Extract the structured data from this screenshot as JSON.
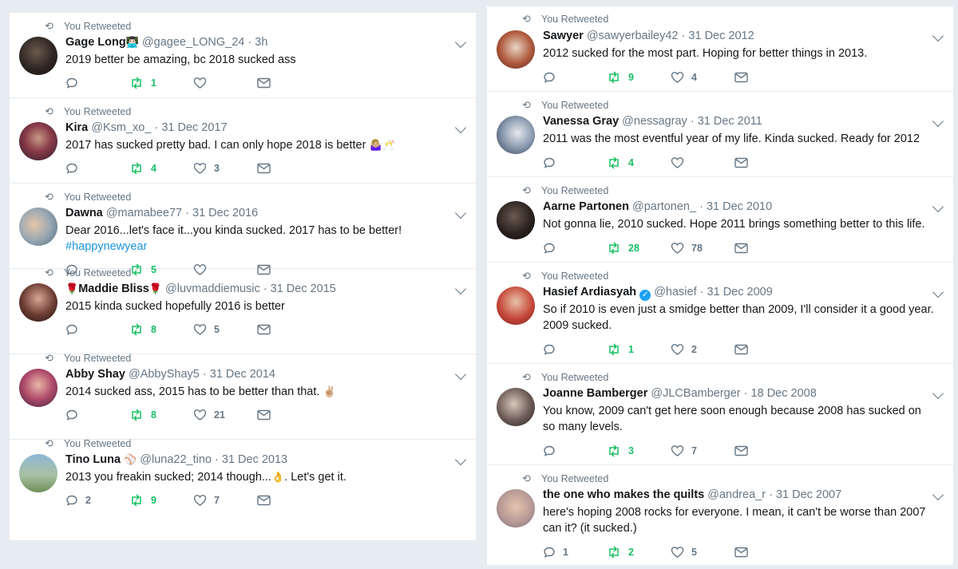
{
  "retweet_label": "You Retweeted",
  "colors": {
    "accent": "#1b95e0",
    "retweet_green": "#17bf63",
    "muted": "#657786",
    "verified": "#1da1f2"
  },
  "left_tweets": [
    {
      "name": "Gage Long",
      "name_suffix": "👨🏻‍💻",
      "handle": "@gagee_LONG_24",
      "date": "3h",
      "text": "2019 better be amazing, bc 2018 sucked ass",
      "replies": "",
      "retweets": "1",
      "likes": ""
    },
    {
      "name": "Kira",
      "handle": "@Ksm_xo_",
      "date": "31 Dec 2017",
      "text": "2017 has sucked pretty bad. I can only hope 2018 is better",
      "text_emoji": "🤷🏼‍♀️🥂",
      "replies": "",
      "retweets": "4",
      "likes": "3"
    },
    {
      "name": "Dawna",
      "handle": "@mamabee77",
      "date": "31 Dec 2016",
      "text": "Dear 2016...let's face it...you kinda sucked. 2017 has to be better!",
      "hashtag": "#happynewyear",
      "replies": "",
      "retweets": "5",
      "likes": ""
    },
    {
      "name_prefix": "🌹",
      "name": "Maddie Bliss",
      "name_suffix": "🌹",
      "handle": "@luvmaddiemusic",
      "date": "31 Dec 2015",
      "text": "2015 kinda sucked hopefully 2016 is better",
      "replies": "",
      "retweets": "8",
      "likes": "5"
    },
    {
      "name": "Abby Shay",
      "handle": "@AbbyShay5",
      "date": "31 Dec 2014",
      "text": "2014 sucked ass, 2015 has to be better than that.",
      "text_emoji": "✌🏼",
      "replies": "",
      "retweets": "8",
      "likes": "21"
    },
    {
      "name": "Tino Luna",
      "name_suffix": "⚾",
      "handle": "@luna22_tino",
      "date": "31 Dec 2013",
      "text": "2013 you freakin sucked; 2014 though...",
      "text_emoji": "👌",
      "text_tail": ". Let's get it.",
      "replies": "2",
      "retweets": "9",
      "likes": "7"
    }
  ],
  "right_tweets": [
    {
      "name": "Sawyer",
      "handle": "@sawyerbailey42",
      "date": "31 Dec 2012",
      "text": "2012 sucked for the most part. Hoping for better things in 2013.",
      "replies": "",
      "retweets": "9",
      "likes": "4"
    },
    {
      "name": "Vanessa Gray",
      "handle": "@nessagray",
      "date": "31 Dec 2011",
      "text": "2011 was the most eventful year of my life. Kinda sucked. Ready for 2012",
      "replies": "",
      "retweets": "4",
      "likes": ""
    },
    {
      "name": "Aarne Partonen",
      "handle": "@partonen_",
      "date": "31 Dec 2010",
      "text": "Not gonna lie, 2010 sucked. Hope 2011 brings something better to this life.",
      "replies": "",
      "retweets": "28",
      "likes": "78"
    },
    {
      "name": "Hasief Ardiasyah",
      "verified": true,
      "handle": "@hasief",
      "date": "31 Dec 2009",
      "text": "So if 2010 is even just a smidge better than 2009, I'll consider it a good year. 2009 sucked.",
      "replies": "",
      "retweets": "1",
      "likes": "2"
    },
    {
      "name": "Joanne Bamberger",
      "handle": "@JLCBamberger",
      "date": "18 Dec 2008",
      "text": "You know, 2009 can't get here soon enough because 2008 has sucked on so many levels.",
      "replies": "",
      "retweets": "3",
      "likes": "7"
    },
    {
      "name": "the one who makes the quilts",
      "handle": "@andrea_r",
      "date": "31 Dec 2007",
      "text": "here's hoping 2008 rocks for everyone. I mean, it can't be worse than 2007 can it? (it sucked.)",
      "replies": "1",
      "retweets": "2",
      "likes": "5"
    }
  ]
}
